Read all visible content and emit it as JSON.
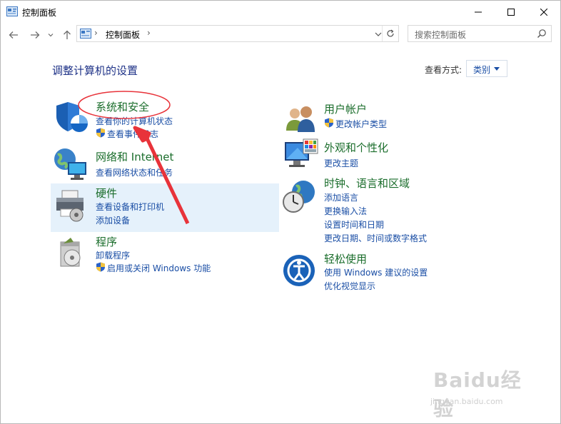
{
  "window": {
    "title": "控制面板",
    "controls": {
      "minimize": "minimize-icon",
      "maximize": "maximize-icon",
      "close": "close-icon"
    }
  },
  "nav": {
    "address": {
      "separator": "›",
      "path": "控制面板"
    },
    "search": {
      "placeholder": "搜索控制面板"
    }
  },
  "header": {
    "title": "调整计算机的设置",
    "view_by_label": "查看方式:",
    "view_by_value": "类别"
  },
  "categories": [
    {
      "title": "系统和安全",
      "icon": "system-security-icon",
      "links": [
        {
          "label": "查看你的计算机状态",
          "shield": false
        },
        {
          "label": "查看事件日志",
          "shield": true
        }
      ]
    },
    {
      "title": "网络和 Internet",
      "icon": "network-icon",
      "links": [
        {
          "label": "查看网络状态和任务",
          "shield": false
        }
      ]
    },
    {
      "title": "硬件",
      "icon": "hardware-printer-icon",
      "links": [
        {
          "label": "查看设备和打印机",
          "shield": false
        },
        {
          "label": "添加设备",
          "shield": false
        }
      ]
    },
    {
      "title": "程序",
      "icon": "programs-icon",
      "links": [
        {
          "label": "卸载程序",
          "shield": false
        },
        {
          "label": "启用或关闭 Windows 功能",
          "shield": true
        }
      ]
    },
    {
      "title": "用户帐户",
      "icon": "user-accounts-icon",
      "links": [
        {
          "label": "更改帐户类型",
          "shield": true
        }
      ]
    },
    {
      "title": "外观和个性化",
      "icon": "appearance-icon",
      "links": [
        {
          "label": "更改主题",
          "shield": false
        }
      ]
    },
    {
      "title": "时钟、语言和区域",
      "icon": "clock-region-icon",
      "links": [
        {
          "label": "添加语言",
          "shield": false
        },
        {
          "label": "更换输入法",
          "shield": false
        },
        {
          "label": "设置时间和日期",
          "shield": false
        },
        {
          "label": "更改日期、时间或数字格式",
          "shield": false
        }
      ]
    },
    {
      "title": "轻松使用",
      "icon": "ease-of-access-icon",
      "links": [
        {
          "label": "使用 Windows 建议的设置",
          "shield": false
        },
        {
          "label": "优化视觉显示",
          "shield": false
        }
      ]
    }
  ],
  "watermark": {
    "logo": "Baidu经验",
    "url": "jingyan.baidu.com"
  },
  "colors": {
    "title_green": "#1a6d2b",
    "link_blue": "#1a4ea5",
    "heading_blue": "#1e3287",
    "highlight": "#e5f1fb",
    "annotation_red": "#e8333a"
  }
}
